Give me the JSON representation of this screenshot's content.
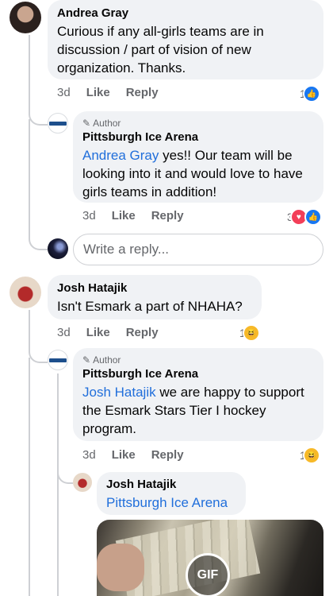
{
  "comments": [
    {
      "author": "Andrea Gray",
      "text": "Curious if any all-girls teams are in discussion / part of vision of new organization. Thanks.",
      "time": "3d",
      "like": "Like",
      "reply": "Reply",
      "reaction_count": "1"
    },
    {
      "author_badge": "Author",
      "author": "Pittsburgh Ice Arena",
      "mention": "Andrea Gray",
      "text": " yes!! Our team will be looking into it and would love to have girls teams in addition!",
      "time": "3d",
      "like": "Like",
      "reply": "Reply",
      "reaction_count": "3"
    },
    {
      "author": "Josh Hatajik",
      "text": "Isn't Esmark a part of NHAHA?",
      "time": "3d",
      "like": "Like",
      "reply": "Reply",
      "reaction_count": "1"
    },
    {
      "author_badge": "Author",
      "author": "Pittsburgh Ice Arena",
      "mention": "Josh Hatajik",
      "text": " we are happy to support the Esmark Stars Tier I hockey program.",
      "time": "3d",
      "like": "Like",
      "reply": "Reply",
      "reaction_count": "1"
    },
    {
      "author": "Josh Hatajik",
      "mention": "Pittsburgh Ice Arena",
      "gif_label": "GIF"
    }
  ],
  "reply_box": {
    "placeholder": "Write a reply..."
  },
  "colors": {
    "like_blue": "#1877f2",
    "love_red": "#f33e58",
    "haha_yellow": "#f7b928",
    "mention_blue": "#216fdb"
  },
  "icons": [
    "pencil-icon",
    "like-reaction-icon",
    "love-reaction-icon",
    "haha-reaction-icon",
    "gif-badge"
  ]
}
